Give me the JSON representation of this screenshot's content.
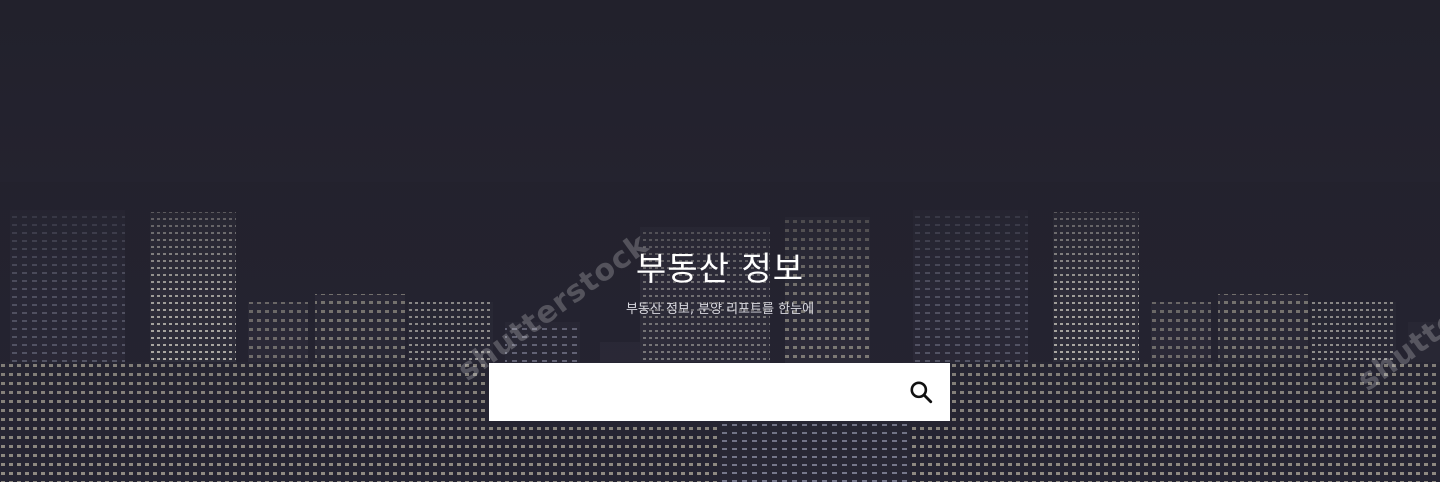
{
  "hero": {
    "title": "부동산 정보",
    "subtitle": "부동산 정보, 분양 리포트를 한눈에",
    "watermark_text": "shutterstock"
  },
  "search": {
    "value": "",
    "placeholder": "",
    "button_icon": "search-icon"
  },
  "colors": {
    "background": "#23222d",
    "search_box": "#ffffff",
    "title_text": "#ffffff"
  }
}
